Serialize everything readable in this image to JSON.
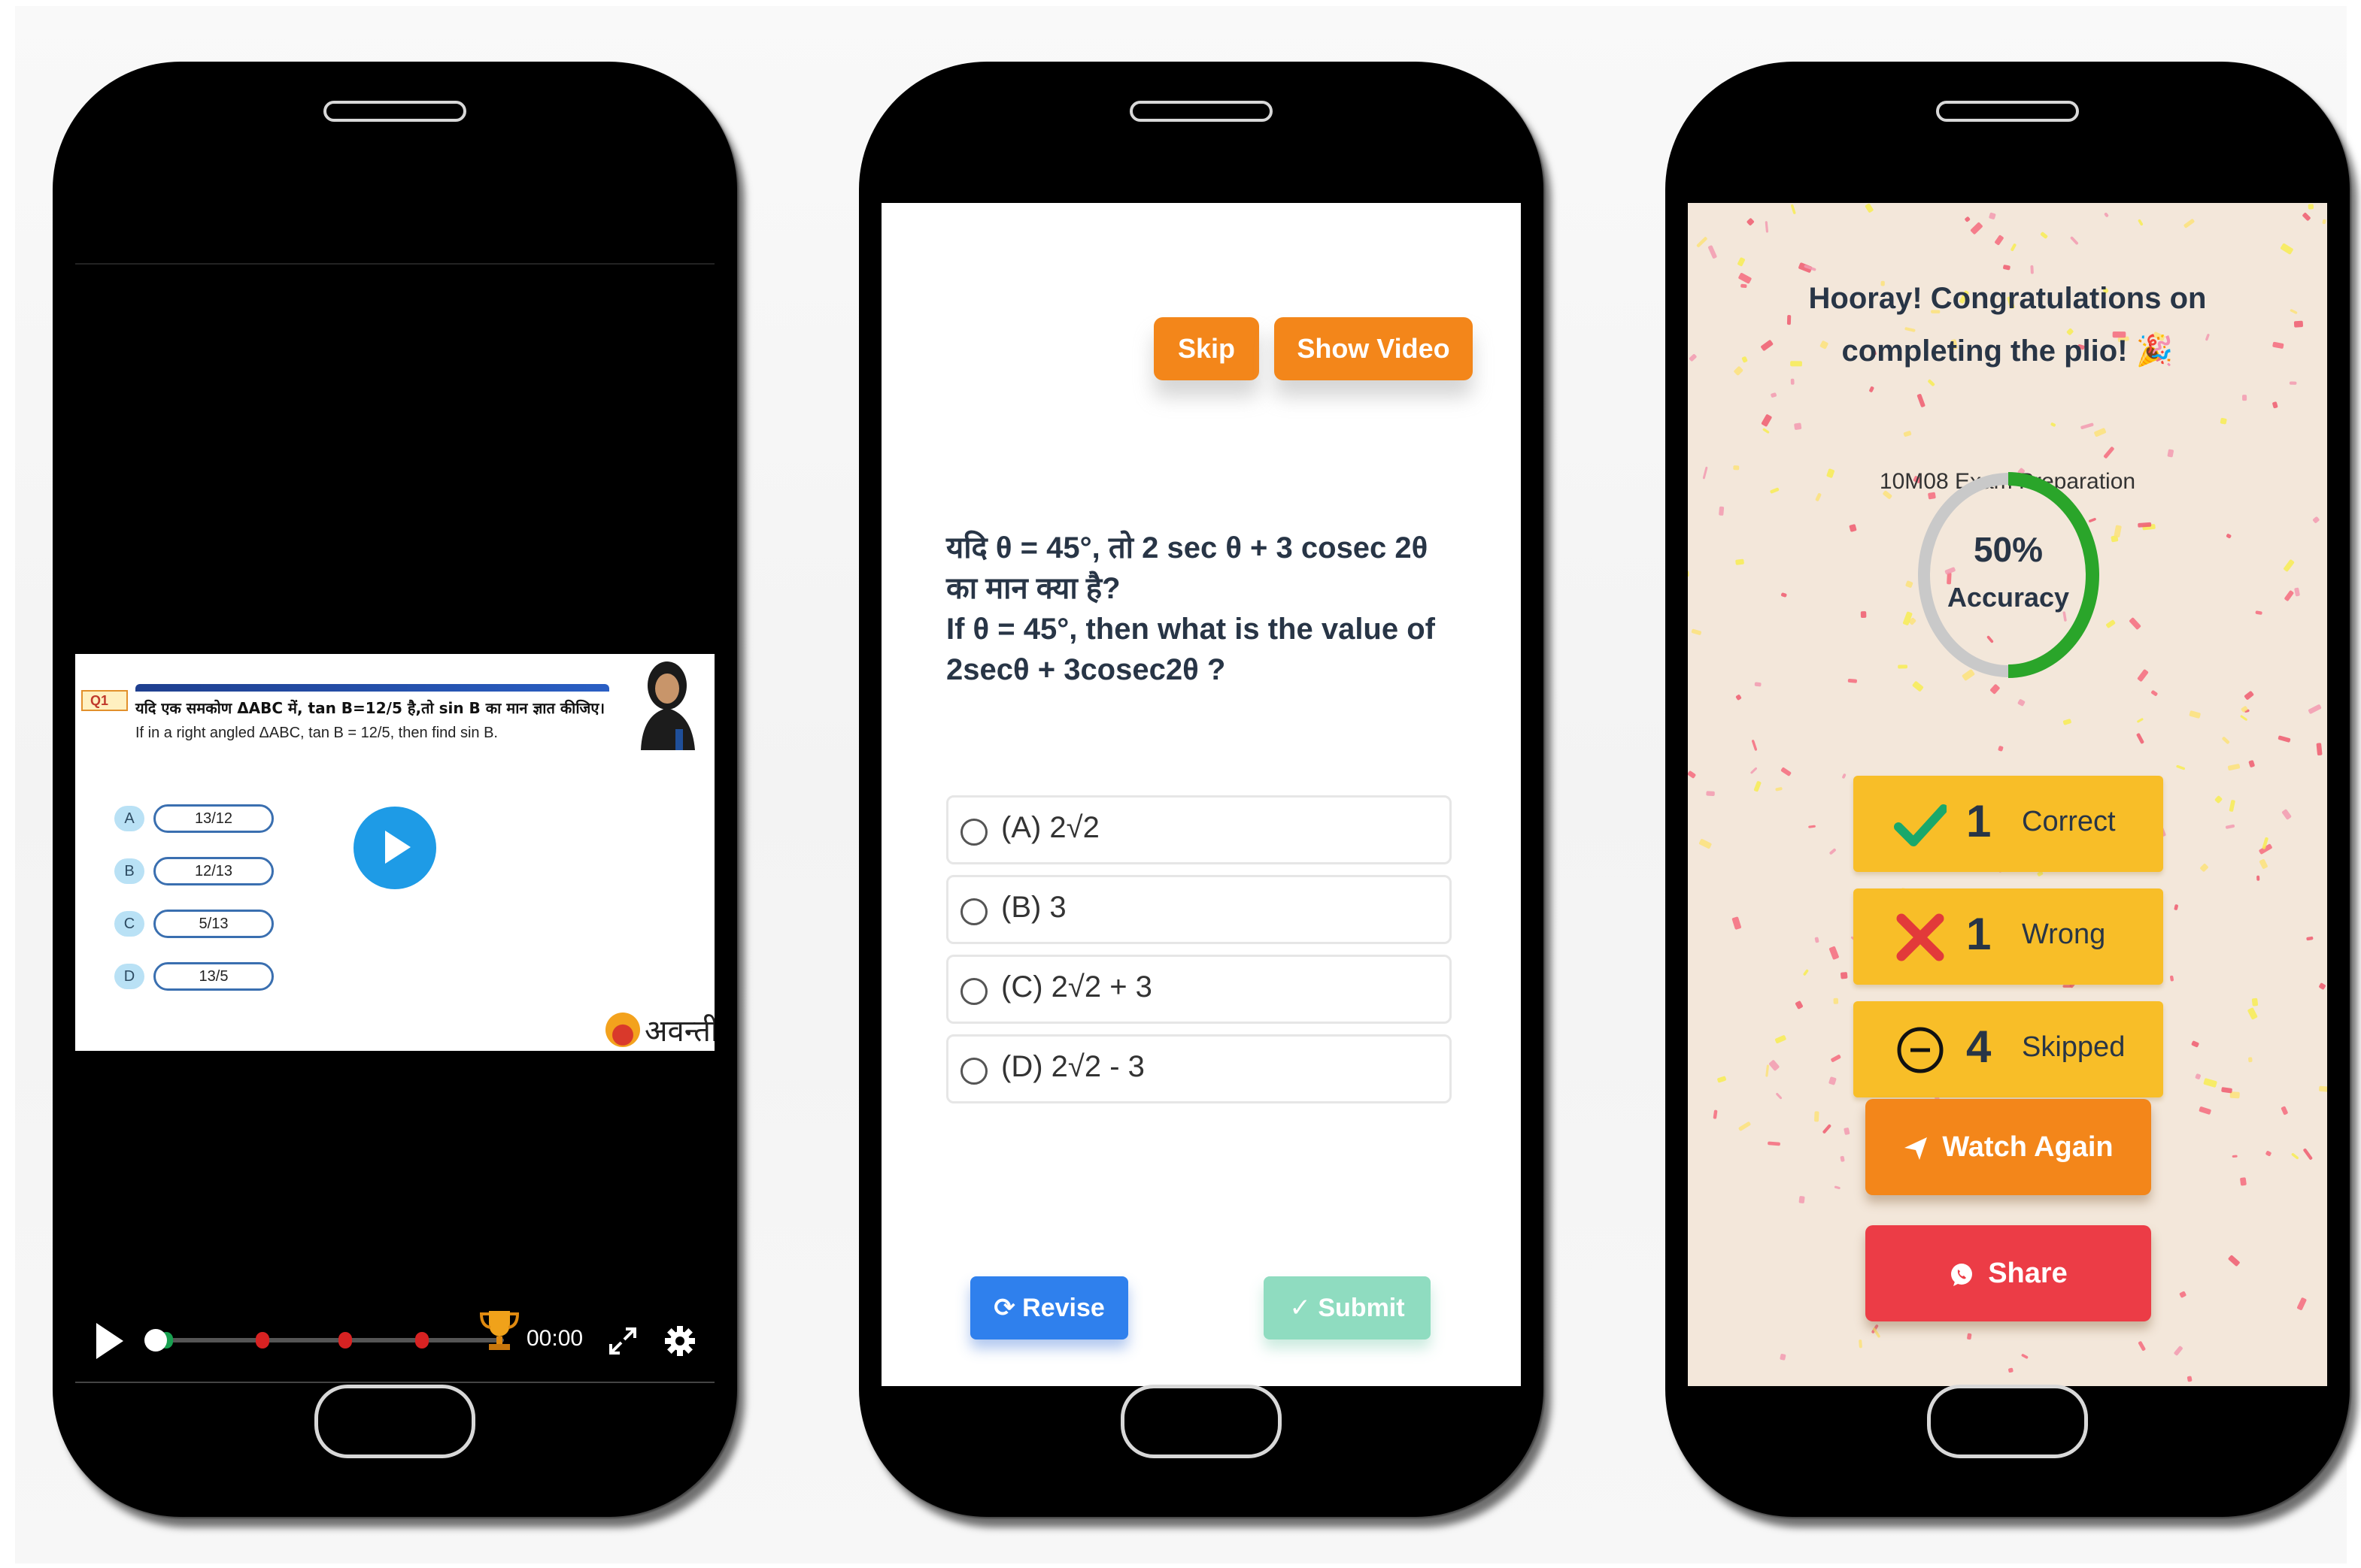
{
  "video_screen": {
    "question_tag": "Q1",
    "question_hindi": "यदि एक समकोण ΔABC में, tan B=12/5 है,तो sin B का मान ज्ञात कीजिए।",
    "question_english": "If in a right angled ΔABC, tan B = 12/5, then find sin B.",
    "options": [
      {
        "letter": "A",
        "value": "13/12"
      },
      {
        "letter": "B",
        "value": "12/13"
      },
      {
        "letter": "C",
        "value": "5/13"
      },
      {
        "letter": "D",
        "value": "13/5"
      }
    ],
    "brand_name": "अवन्ती",
    "player": {
      "time": "00:00",
      "progress_fraction": 0.0
    }
  },
  "question_screen": {
    "skip_label": "Skip",
    "show_video_label": "Show Video",
    "question_lines": [
      "यदि θ = 45°, तो 2 sec θ + 3 cosec 2θ",
      "का मान क्या है?",
      "If θ = 45°, then what is the value of",
      "2secθ + 3cosec2θ ?"
    ],
    "answers": [
      "(A) 2√2",
      "(B) 3",
      "(C) 2√2 + 3",
      "(D) 2√2 - 3"
    ],
    "revise_label": "⟳ Revise",
    "submit_label": "✓ Submit"
  },
  "results_screen": {
    "title_line1": "Hooray! Congratulations on",
    "title_line2": "completing the plio! 🎉",
    "subtitle": "10M08 Exam Preparation",
    "accuracy_value": "50%",
    "accuracy_label": "Accuracy",
    "accuracy_fraction": 0.5,
    "stats": [
      {
        "icon": "check-icon",
        "count": "1",
        "label": "Correct"
      },
      {
        "icon": "cross-icon",
        "count": "1",
        "label": "Wrong"
      },
      {
        "icon": "minus-circle-icon",
        "count": "4",
        "label": "Skipped"
      }
    ],
    "watch_again_label": "Watch Again",
    "share_label": "Share"
  },
  "colors": {
    "orange": "#f3861a",
    "blue": "#2f80ed",
    "mint": "#8fdcc0",
    "stat_yellow": "#f8be28",
    "share_red": "#ec3c46",
    "ring_green": "#2aa52a",
    "ring_grey": "#c9c9c9"
  }
}
